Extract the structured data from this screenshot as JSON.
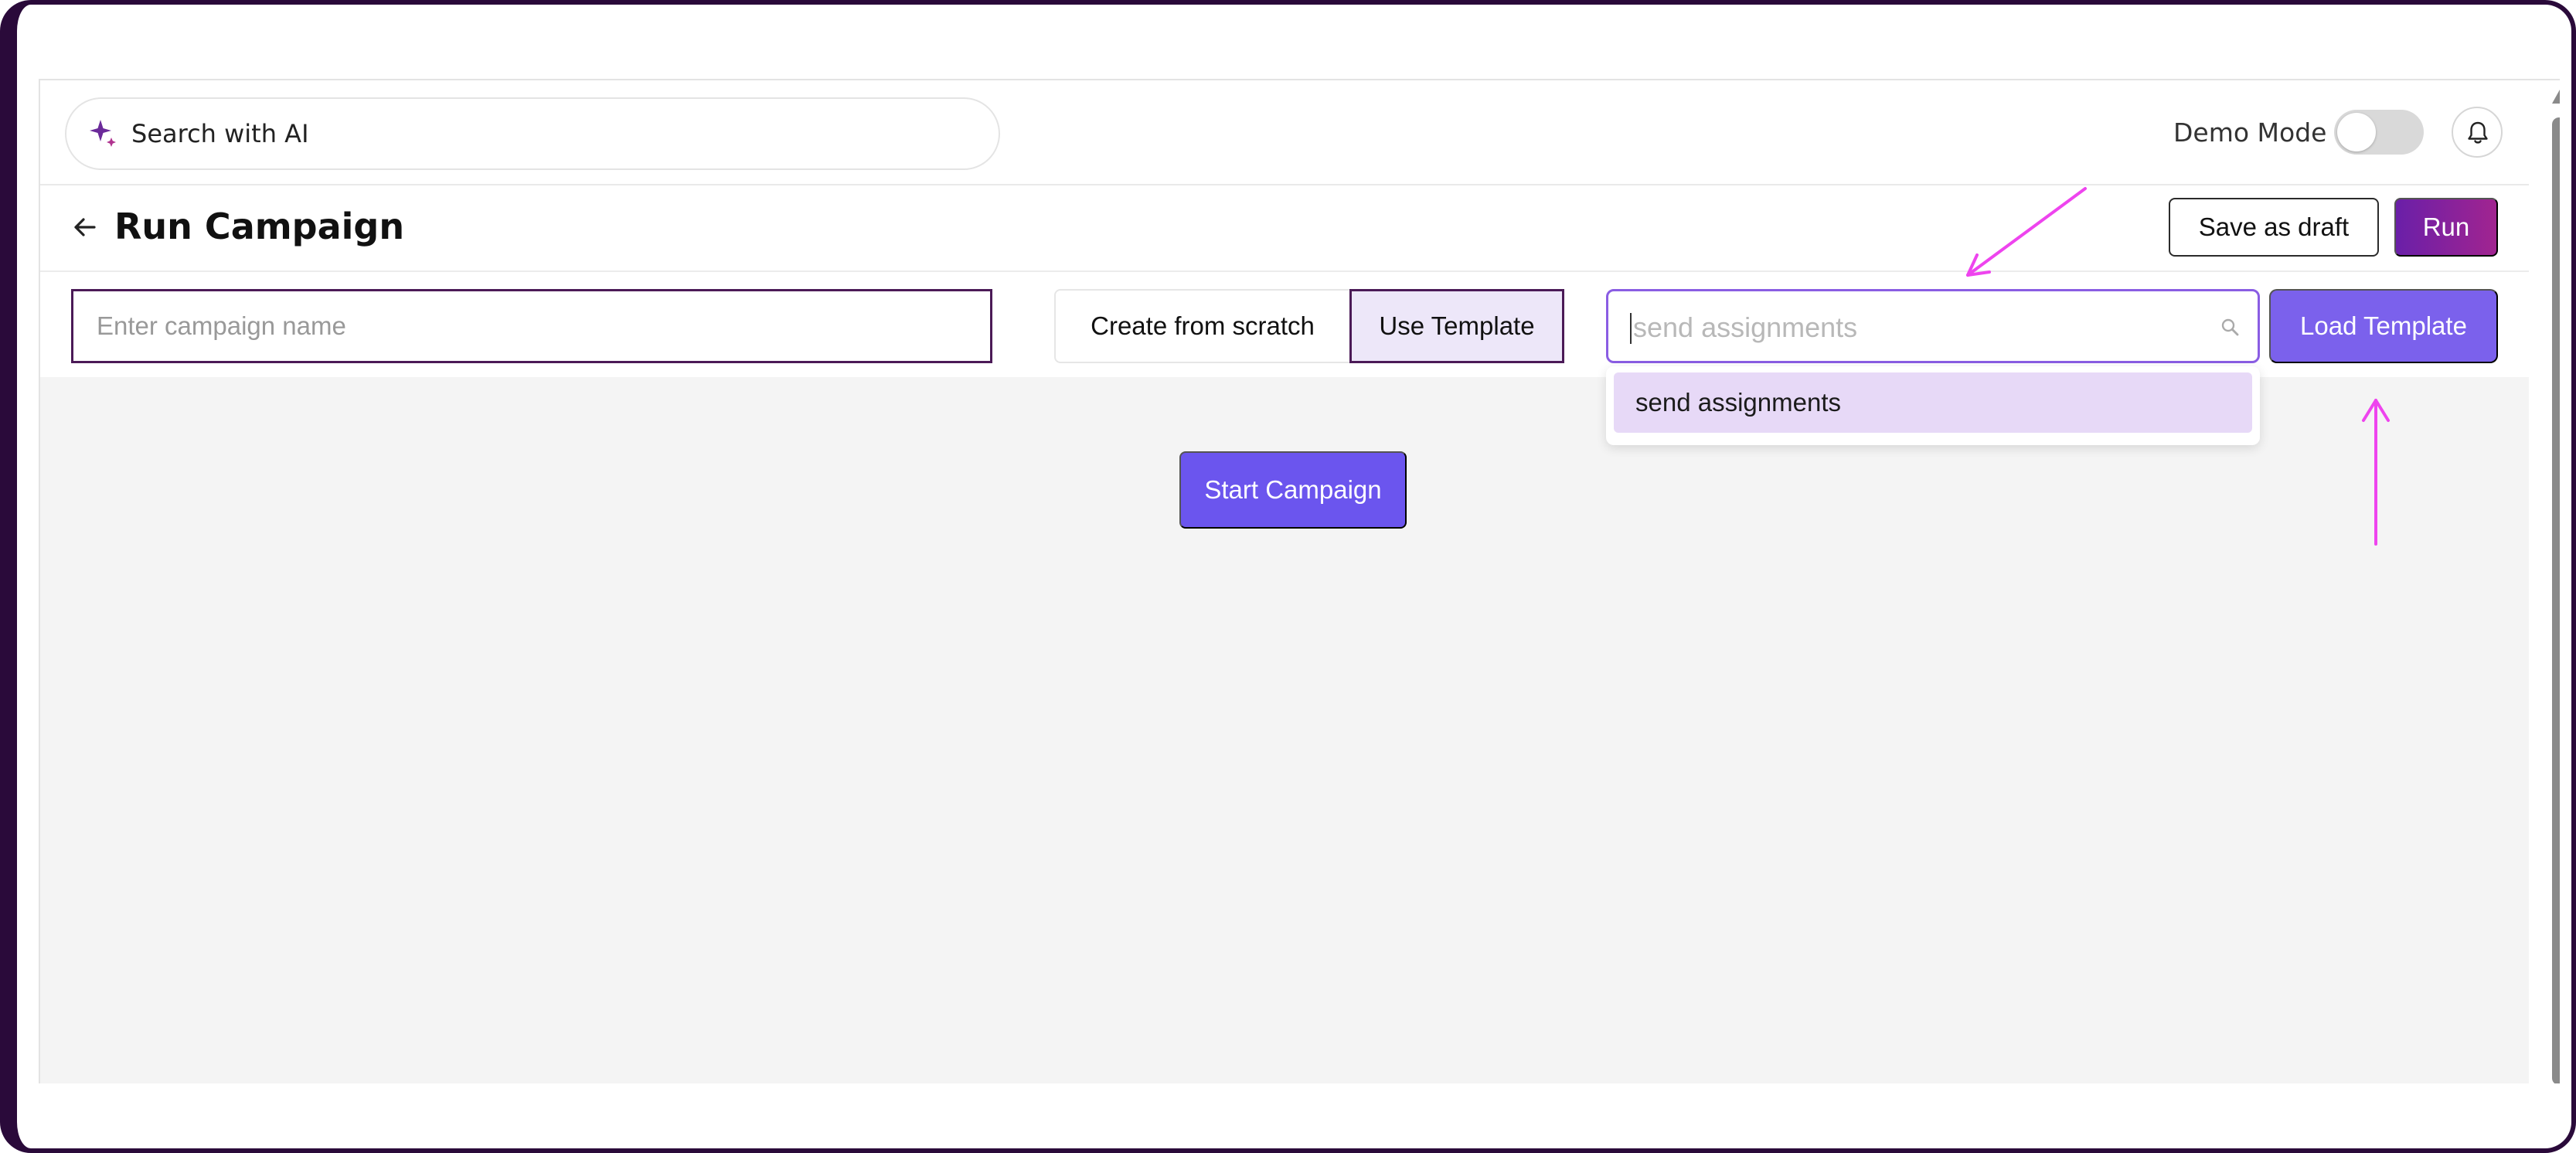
{
  "topbar": {
    "search_label": "Search with AI",
    "demo_mode_label": "Demo Mode",
    "demo_mode_on": false,
    "icons": [
      "sparkle-icon",
      "bell-icon"
    ]
  },
  "header": {
    "title": "Run Campaign",
    "save_draft_label": "Save as draft",
    "run_label": "Run"
  },
  "controls": {
    "campaign_name_placeholder": "Enter campaign name",
    "create_scratch_label": "Create from scratch",
    "use_template_label": "Use Template",
    "template_search_placeholder": "send assignments",
    "load_template_label": "Load Template"
  },
  "dropdown": {
    "options": [
      "send assignments"
    ]
  },
  "content": {
    "start_campaign_label": "Start Campaign"
  },
  "colors": {
    "accent": "#7b61ec",
    "start_button": "#6b55ee",
    "run_gradient_start": "#6a1fa8",
    "run_gradient_end": "#a12490",
    "selected_outline": "#4b1a57",
    "annotation_arrow": "#ee44ee",
    "dropdown_highlight": "#e7d9f7"
  }
}
